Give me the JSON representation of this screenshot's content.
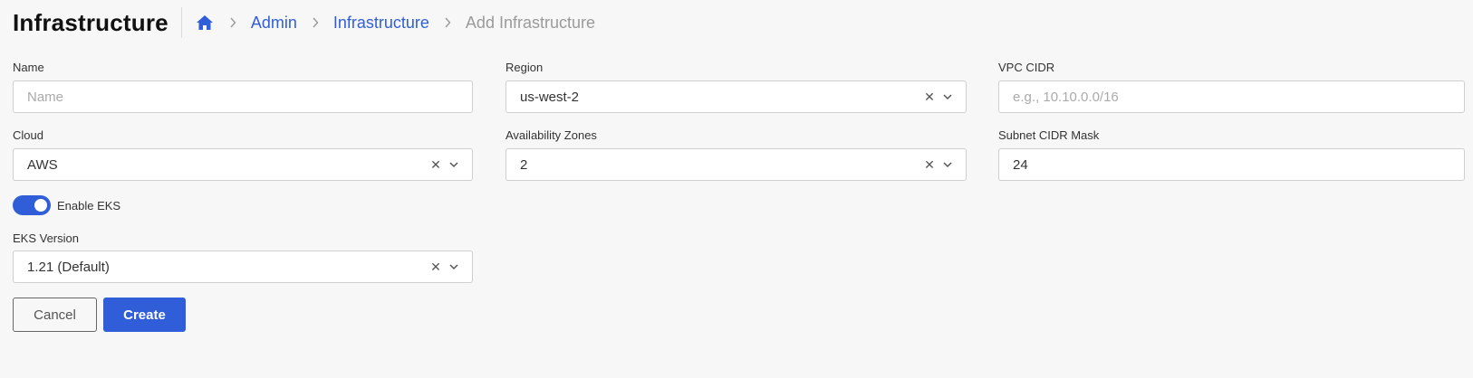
{
  "header": {
    "title": "Infrastructure",
    "breadcrumb": {
      "home_icon": "home-icon",
      "items": [
        "Admin",
        "Infrastructure",
        "Add Infrastructure"
      ]
    }
  },
  "form": {
    "name": {
      "label": "Name",
      "value": "",
      "placeholder": "Name"
    },
    "region": {
      "label": "Region",
      "value": "us-west-2"
    },
    "vpc_cidr": {
      "label": "VPC CIDR",
      "value": "",
      "placeholder": "e.g., 10.10.0.0/16"
    },
    "cloud": {
      "label": "Cloud",
      "value": "AWS"
    },
    "availability_zones": {
      "label": "Availability Zones",
      "value": "2"
    },
    "subnet_cidr_mask": {
      "label": "Subnet CIDR Mask",
      "value": "24"
    },
    "enable_eks": {
      "label": "Enable EKS",
      "checked": true
    },
    "eks_version": {
      "label": "EKS Version",
      "value": "1.21 (Default)"
    }
  },
  "actions": {
    "cancel_label": "Cancel",
    "create_label": "Create"
  },
  "colors": {
    "accent": "#2f5ed8",
    "background": "#f7f7f7",
    "muted_text": "#9a9a9a"
  }
}
